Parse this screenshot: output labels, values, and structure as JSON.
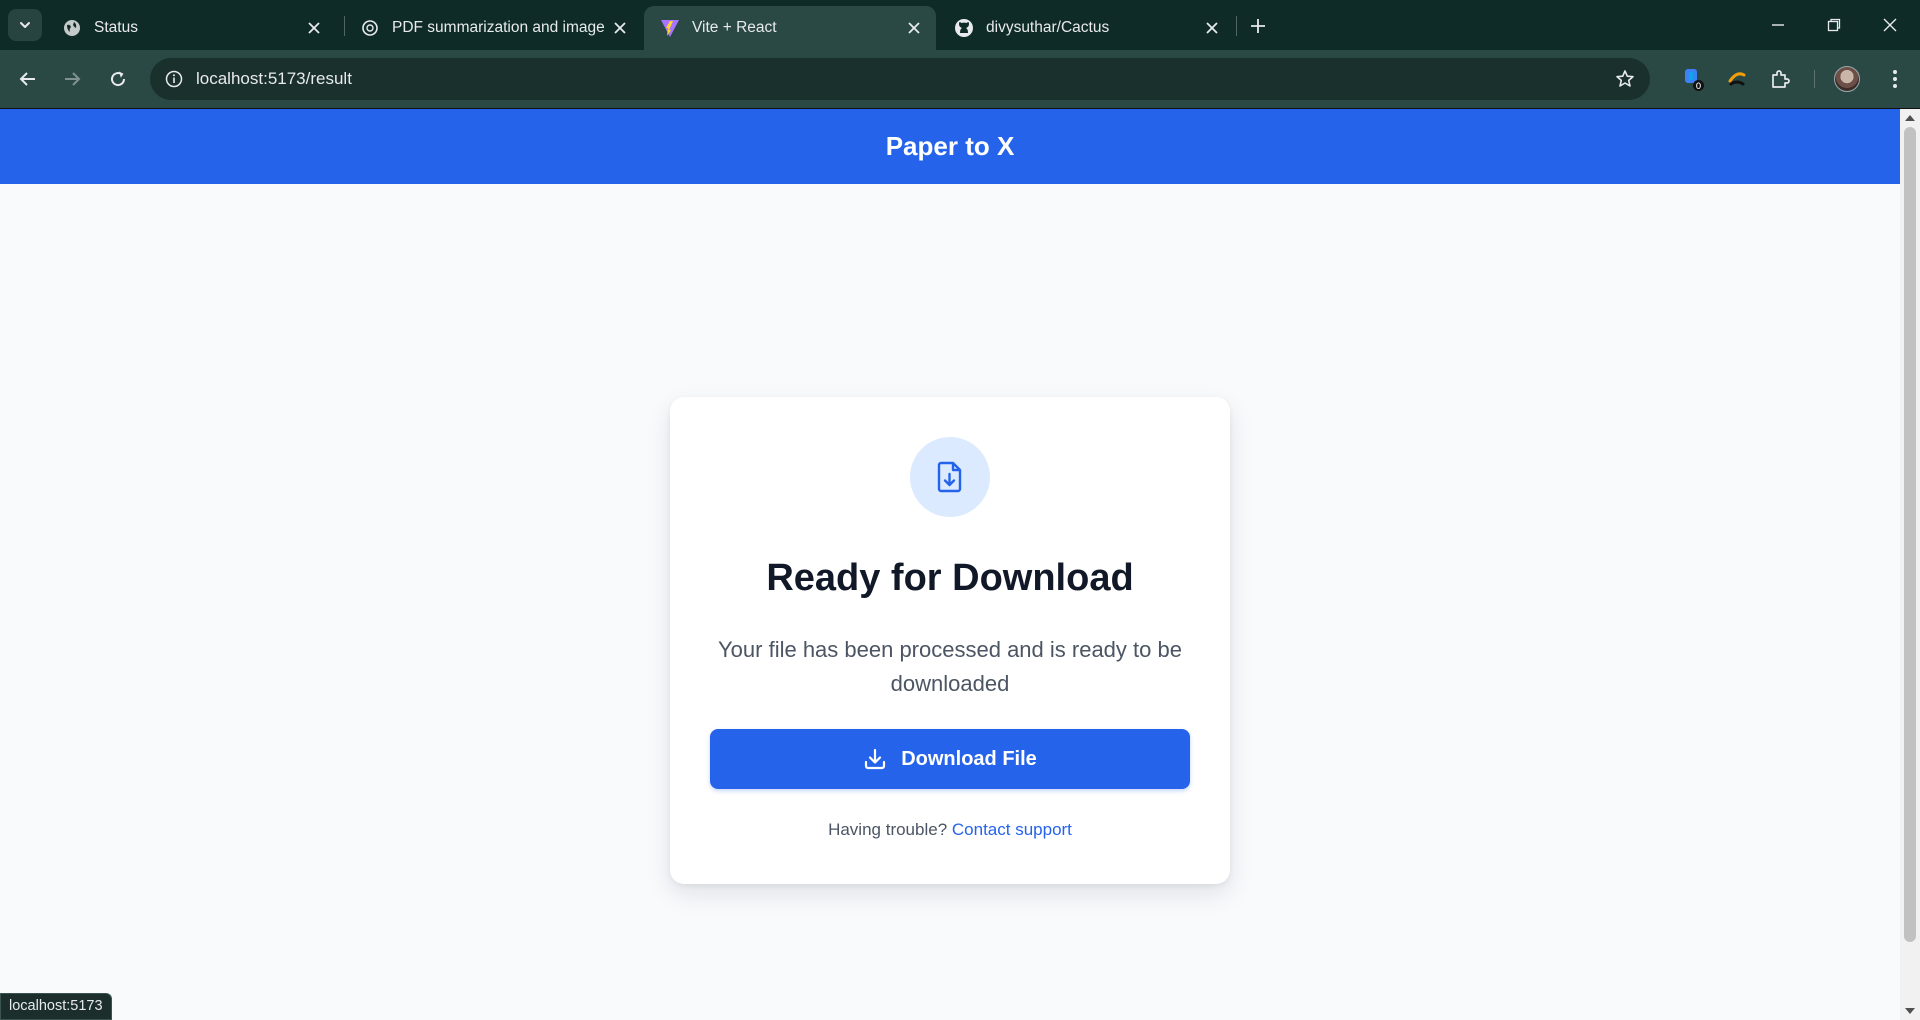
{
  "browser": {
    "tabs": [
      {
        "title": "Status",
        "favicon": "globe-icon",
        "active": false
      },
      {
        "title": "PDF summarization and image",
        "favicon": "openai-icon",
        "active": false
      },
      {
        "title": "Vite + React",
        "favicon": "vite-icon",
        "active": true
      },
      {
        "title": "divysuthar/Cactus",
        "favicon": "github-icon",
        "active": false
      }
    ],
    "url": "localhost:5173/result",
    "extension_badge": "0",
    "status_url": "localhost:5173"
  },
  "app": {
    "title": "Paper to X",
    "brand_color": "#2563eb"
  },
  "card": {
    "icon": "file-download-icon",
    "title": "Ready for Download",
    "description": "Your file has been processed and is ready to be downloaded",
    "button_label": "Download File",
    "help_text": "Having trouble?",
    "help_link": "Contact support"
  }
}
